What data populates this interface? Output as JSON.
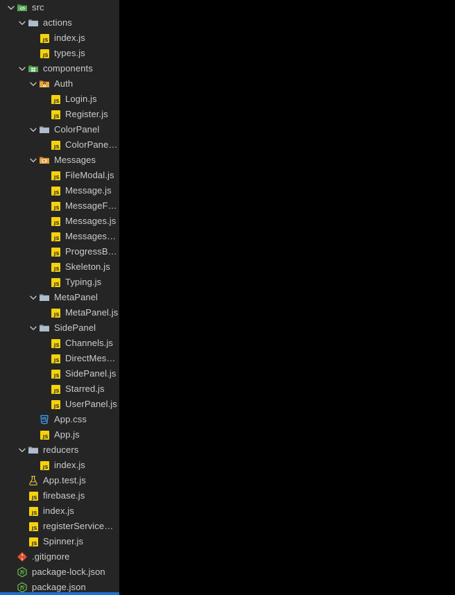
{
  "theme": {
    "sidebar_bg": "#252526",
    "editor_bg": "#000000",
    "text": "#cccccc",
    "js_yellow": "#f5d20e",
    "folder_gray": "#8a9aa9",
    "folder_green": "#5aa85a",
    "folder_orange": "#e8a33d",
    "css_blue": "#42a5f5",
    "git_red": "#e8502a",
    "node_green": "#6cbf4b",
    "test_yellow": "#e8c547",
    "scrollbar_blue": "#1f6fd0"
  },
  "explorer": {
    "name": "file-explorer",
    "scrollbar": {
      "name": "horizontal-scrollbar",
      "orientation": "horizontal"
    },
    "rows": [
      {
        "label": "src",
        "depth": 0,
        "type": "folder",
        "icon": "folder-src-icon",
        "expanded": true,
        "truncated": false
      },
      {
        "label": "actions",
        "depth": 1,
        "type": "folder",
        "icon": "folder-icon",
        "expanded": true,
        "truncated": false
      },
      {
        "label": "index.js",
        "depth": 2,
        "type": "file",
        "icon": "js-file-icon",
        "expanded": null,
        "truncated": false
      },
      {
        "label": "types.js",
        "depth": 2,
        "type": "file",
        "icon": "js-file-icon",
        "expanded": null,
        "truncated": false
      },
      {
        "label": "components",
        "depth": 1,
        "type": "folder",
        "icon": "folder-components-icon",
        "expanded": true,
        "truncated": false
      },
      {
        "label": "Auth",
        "depth": 2,
        "type": "folder",
        "icon": "folder-auth-icon",
        "expanded": true,
        "truncated": false
      },
      {
        "label": "Login.js",
        "depth": 3,
        "type": "file",
        "icon": "js-file-icon",
        "expanded": null,
        "truncated": false
      },
      {
        "label": "Register.js",
        "depth": 3,
        "type": "file",
        "icon": "js-file-icon",
        "expanded": null,
        "truncated": false
      },
      {
        "label": "ColorPanel",
        "depth": 2,
        "type": "folder",
        "icon": "folder-icon",
        "expanded": true,
        "truncated": false
      },
      {
        "label": "ColorPanel.js",
        "depth": 3,
        "type": "file",
        "icon": "js-file-icon",
        "expanded": null,
        "truncated": false
      },
      {
        "label": "Messages",
        "depth": 2,
        "type": "folder",
        "icon": "folder-messages-icon",
        "expanded": true,
        "truncated": false
      },
      {
        "label": "FileModal.js",
        "depth": 3,
        "type": "file",
        "icon": "js-file-icon",
        "expanded": null,
        "truncated": false
      },
      {
        "label": "Message.js",
        "depth": 3,
        "type": "file",
        "icon": "js-file-icon",
        "expanded": null,
        "truncated": false
      },
      {
        "label": "MessageForm.js",
        "depth": 3,
        "type": "file",
        "icon": "js-file-icon",
        "expanded": null,
        "truncated": false
      },
      {
        "label": "Messages.js",
        "depth": 3,
        "type": "file",
        "icon": "js-file-icon",
        "expanded": null,
        "truncated": false
      },
      {
        "label": "MessagesHead...",
        "depth": 3,
        "type": "file",
        "icon": "js-file-icon",
        "expanded": null,
        "truncated": true
      },
      {
        "label": "ProgressBar.js",
        "depth": 3,
        "type": "file",
        "icon": "js-file-icon",
        "expanded": null,
        "truncated": false
      },
      {
        "label": "Skeleton.js",
        "depth": 3,
        "type": "file",
        "icon": "js-file-icon",
        "expanded": null,
        "truncated": false
      },
      {
        "label": "Typing.js",
        "depth": 3,
        "type": "file",
        "icon": "js-file-icon",
        "expanded": null,
        "truncated": false
      },
      {
        "label": "MetaPanel",
        "depth": 2,
        "type": "folder",
        "icon": "folder-icon",
        "expanded": true,
        "truncated": false
      },
      {
        "label": "MetaPanel.js",
        "depth": 3,
        "type": "file",
        "icon": "js-file-icon",
        "expanded": null,
        "truncated": false
      },
      {
        "label": "SidePanel",
        "depth": 2,
        "type": "folder",
        "icon": "folder-icon",
        "expanded": true,
        "truncated": false
      },
      {
        "label": "Channels.js",
        "depth": 3,
        "type": "file",
        "icon": "js-file-icon",
        "expanded": null,
        "truncated": false
      },
      {
        "label": "DirectMessage...",
        "depth": 3,
        "type": "file",
        "icon": "js-file-icon",
        "expanded": null,
        "truncated": true
      },
      {
        "label": "SidePanel.js",
        "depth": 3,
        "type": "file",
        "icon": "js-file-icon",
        "expanded": null,
        "truncated": false
      },
      {
        "label": "Starred.js",
        "depth": 3,
        "type": "file",
        "icon": "js-file-icon",
        "expanded": null,
        "truncated": false
      },
      {
        "label": "UserPanel.js",
        "depth": 3,
        "type": "file",
        "icon": "js-file-icon",
        "expanded": null,
        "truncated": false
      },
      {
        "label": "App.css",
        "depth": 2,
        "type": "file",
        "icon": "css-file-icon",
        "expanded": null,
        "truncated": false
      },
      {
        "label": "App.js",
        "depth": 2,
        "type": "file",
        "icon": "js-file-icon",
        "expanded": null,
        "truncated": false
      },
      {
        "label": "reducers",
        "depth": 1,
        "type": "folder",
        "icon": "folder-icon",
        "expanded": true,
        "truncated": false
      },
      {
        "label": "index.js",
        "depth": 2,
        "type": "file",
        "icon": "js-file-icon",
        "expanded": null,
        "truncated": false
      },
      {
        "label": "App.test.js",
        "depth": 1,
        "type": "file",
        "icon": "test-file-icon",
        "expanded": null,
        "truncated": false
      },
      {
        "label": "firebase.js",
        "depth": 1,
        "type": "file",
        "icon": "js-file-icon",
        "expanded": null,
        "truncated": false
      },
      {
        "label": "index.js",
        "depth": 1,
        "type": "file",
        "icon": "js-file-icon",
        "expanded": null,
        "truncated": false
      },
      {
        "label": "registerServiceWo...",
        "depth": 1,
        "type": "file",
        "icon": "js-file-icon",
        "expanded": null,
        "truncated": true
      },
      {
        "label": "Spinner.js",
        "depth": 1,
        "type": "file",
        "icon": "js-file-icon",
        "expanded": null,
        "truncated": false
      },
      {
        "label": ".gitignore",
        "depth": 0,
        "type": "file",
        "icon": "git-file-icon",
        "expanded": null,
        "truncated": false
      },
      {
        "label": "package-lock.json",
        "depth": 0,
        "type": "file",
        "icon": "node-file-icon",
        "expanded": null,
        "truncated": false
      },
      {
        "label": "package.json",
        "depth": 0,
        "type": "file",
        "icon": "node-file-icon",
        "expanded": null,
        "truncated": false
      }
    ]
  }
}
